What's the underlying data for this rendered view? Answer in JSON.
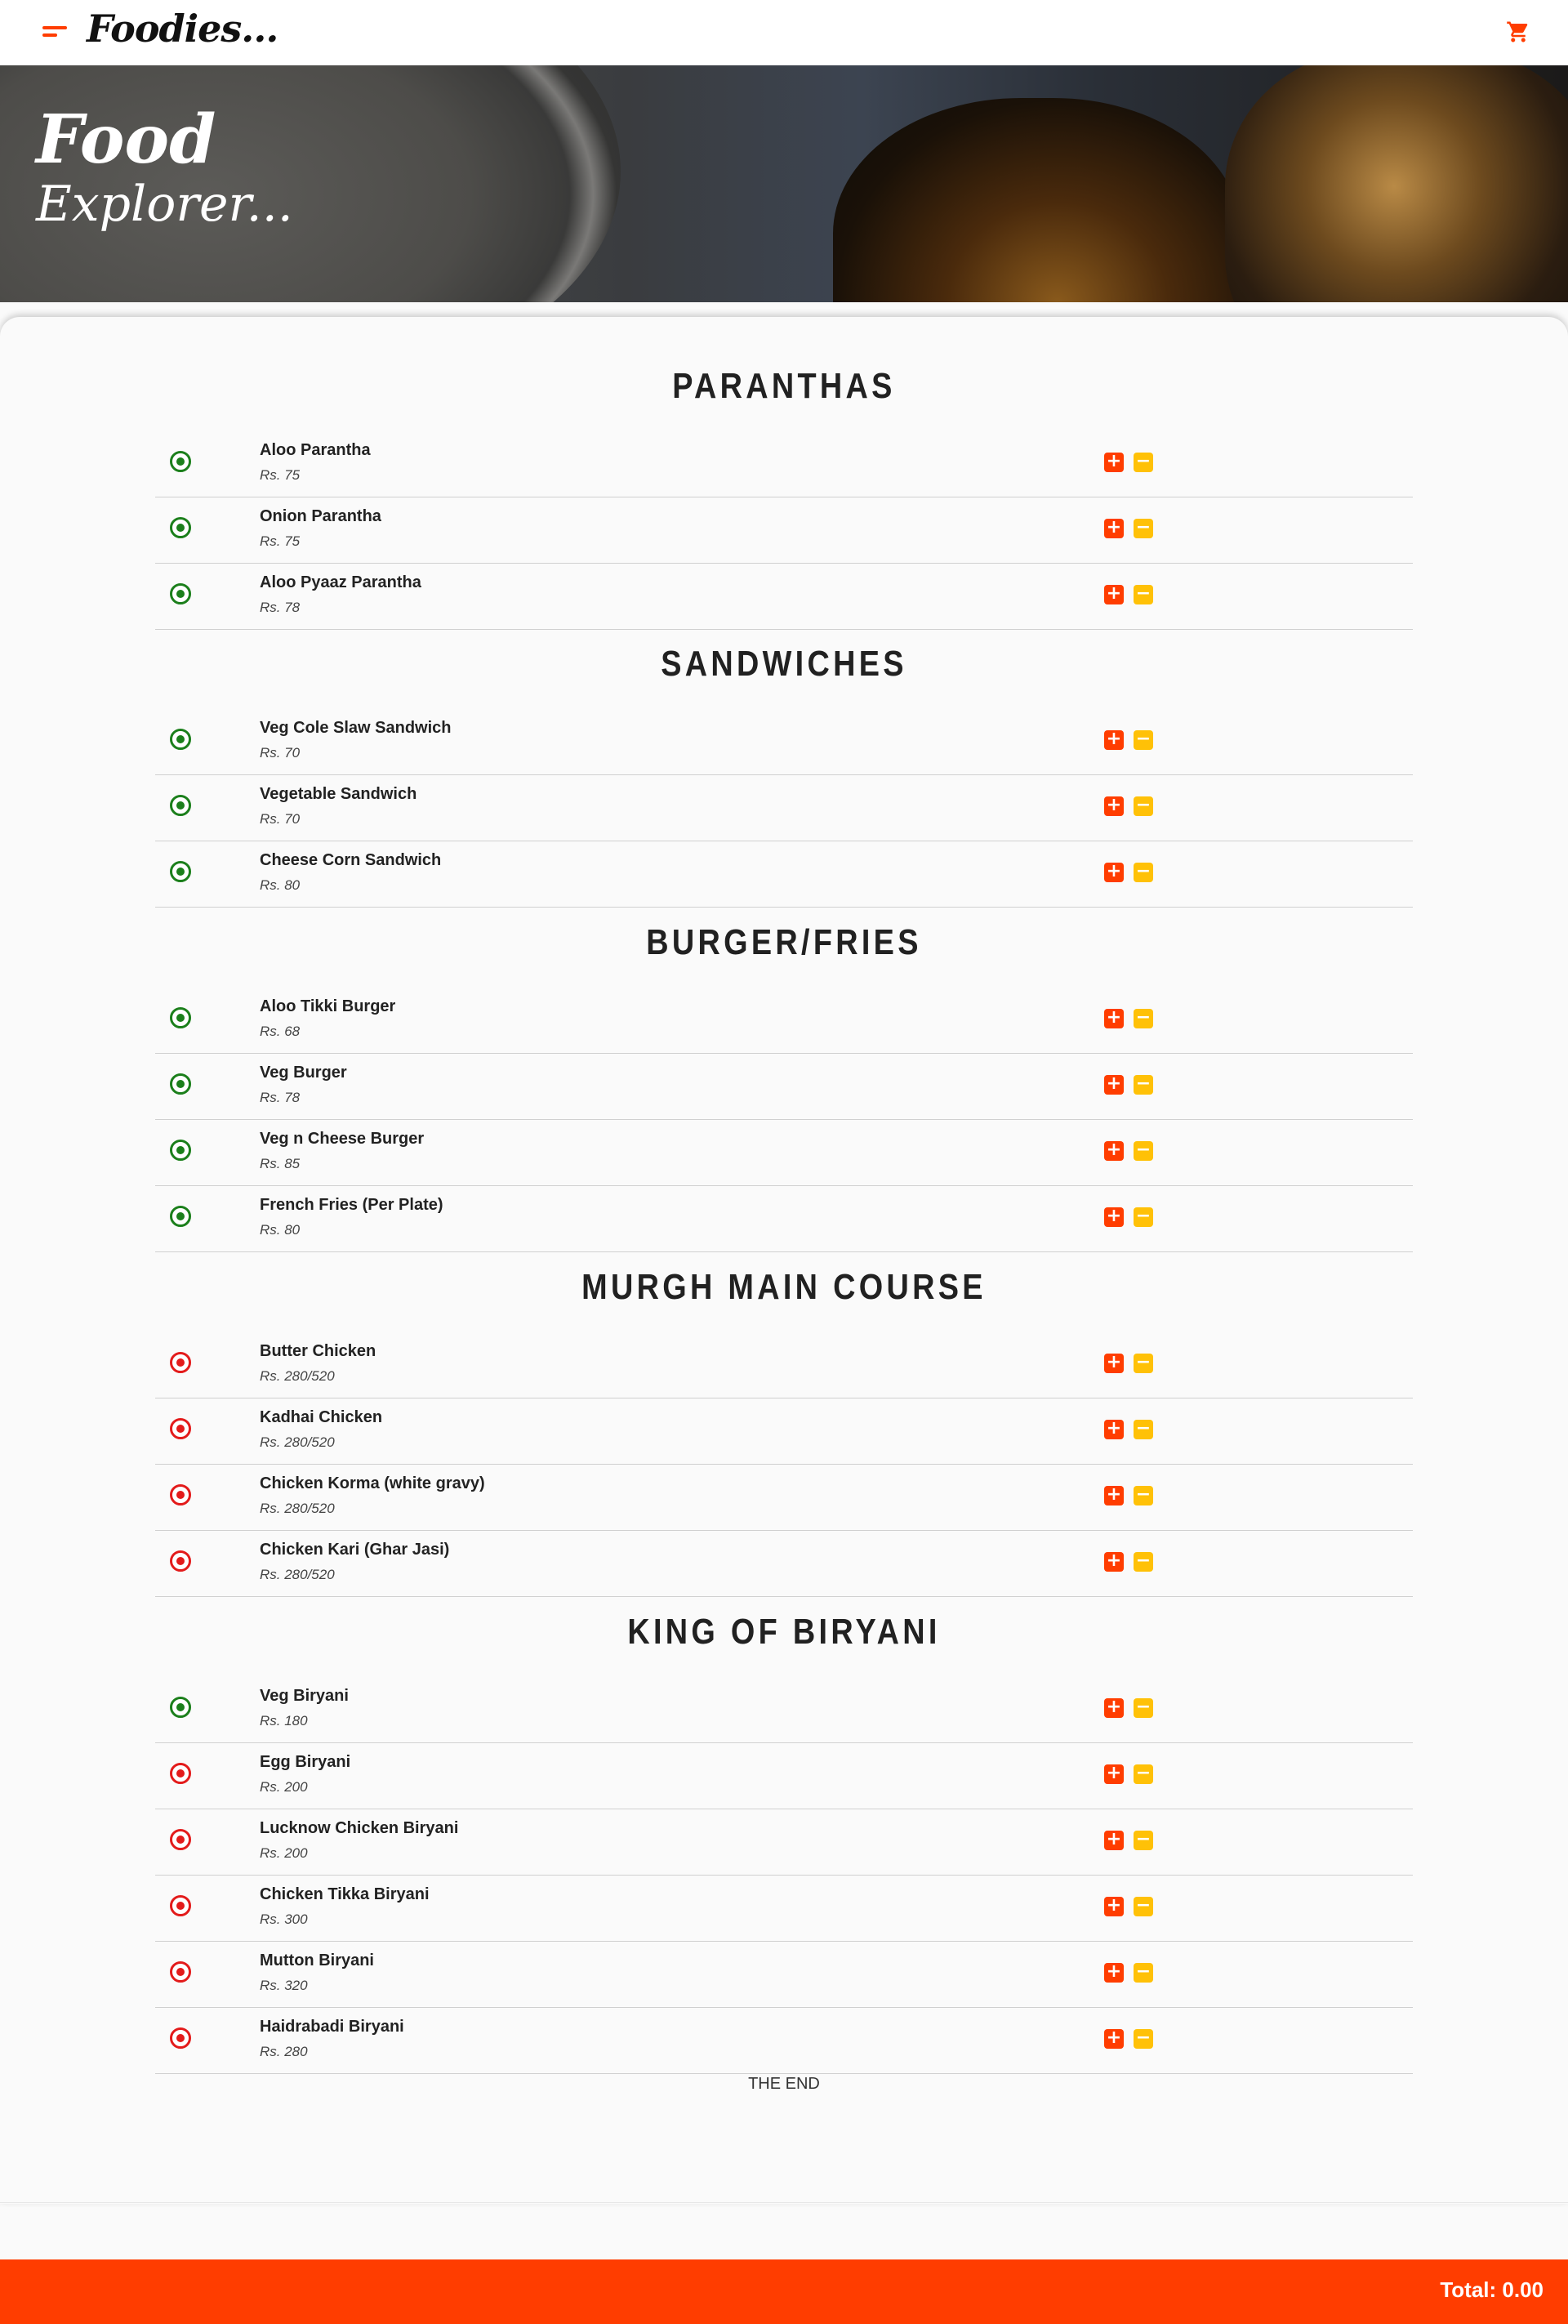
{
  "header": {
    "brand": "Foodies...",
    "menu_icon": "menu-icon",
    "cart_icon": "shopping-cart-icon"
  },
  "hero": {
    "title_line1": "Food",
    "title_line2": "Explorer..."
  },
  "colors": {
    "accent": "#ff3d00",
    "remove": "#ffc107",
    "veg": "#1b7f1b",
    "nonveg": "#e31b1b"
  },
  "sections": [
    {
      "title": "PARANTHAS",
      "items": [
        {
          "name": "Aloo Parantha",
          "price": "Rs. 75",
          "type": "veg"
        },
        {
          "name": "Onion Parantha",
          "price": "Rs. 75",
          "type": "veg"
        },
        {
          "name": "Aloo Pyaaz Parantha",
          "price": "Rs. 78",
          "type": "veg"
        }
      ]
    },
    {
      "title": "SANDWICHES",
      "items": [
        {
          "name": "Veg Cole Slaw Sandwich",
          "price": "Rs. 70",
          "type": "veg"
        },
        {
          "name": "Vegetable Sandwich",
          "price": "Rs. 70",
          "type": "veg"
        },
        {
          "name": "Cheese Corn Sandwich",
          "price": "Rs. 80",
          "type": "veg"
        }
      ]
    },
    {
      "title": "BURGER/FRIES",
      "items": [
        {
          "name": "Aloo Tikki Burger",
          "price": "Rs. 68",
          "type": "veg"
        },
        {
          "name": "Veg Burger",
          "price": "Rs. 78",
          "type": "veg"
        },
        {
          "name": "Veg n Cheese Burger",
          "price": "Rs. 85",
          "type": "veg"
        },
        {
          "name": "French Fries (Per Plate)",
          "price": "Rs. 80",
          "type": "veg"
        }
      ]
    },
    {
      "title": "MURGH MAIN COURSE",
      "items": [
        {
          "name": "Butter Chicken",
          "price": "Rs. 280/520",
          "type": "nonveg"
        },
        {
          "name": "Kadhai Chicken",
          "price": "Rs. 280/520",
          "type": "nonveg"
        },
        {
          "name": "Chicken Korma (white gravy)",
          "price": "Rs. 280/520",
          "type": "nonveg"
        },
        {
          "name": "Chicken Kari (Ghar Jasi)",
          "price": "Rs. 280/520",
          "type": "nonveg"
        }
      ]
    },
    {
      "title": "KING OF BIRYANI",
      "items": [
        {
          "name": "Veg Biryani",
          "price": "Rs. 180",
          "type": "veg"
        },
        {
          "name": "Egg Biryani",
          "price": "Rs. 200",
          "type": "nonveg"
        },
        {
          "name": "Lucknow Chicken Biryani",
          "price": "Rs. 200",
          "type": "nonveg"
        },
        {
          "name": "Chicken Tikka Biryani",
          "price": "Rs. 300",
          "type": "nonveg"
        },
        {
          "name": "Mutton Biryani",
          "price": "Rs. 320",
          "type": "nonveg"
        },
        {
          "name": "Haidrabadi Biryani",
          "price": "Rs. 280",
          "type": "nonveg"
        }
      ]
    }
  ],
  "buttons": {
    "add_icon": "plus-icon",
    "remove_icon": "minus-icon",
    "add_glyph": "+",
    "remove_glyph": "−"
  },
  "end_text": "THE END",
  "footer": {
    "total": "Total: 0.00"
  }
}
